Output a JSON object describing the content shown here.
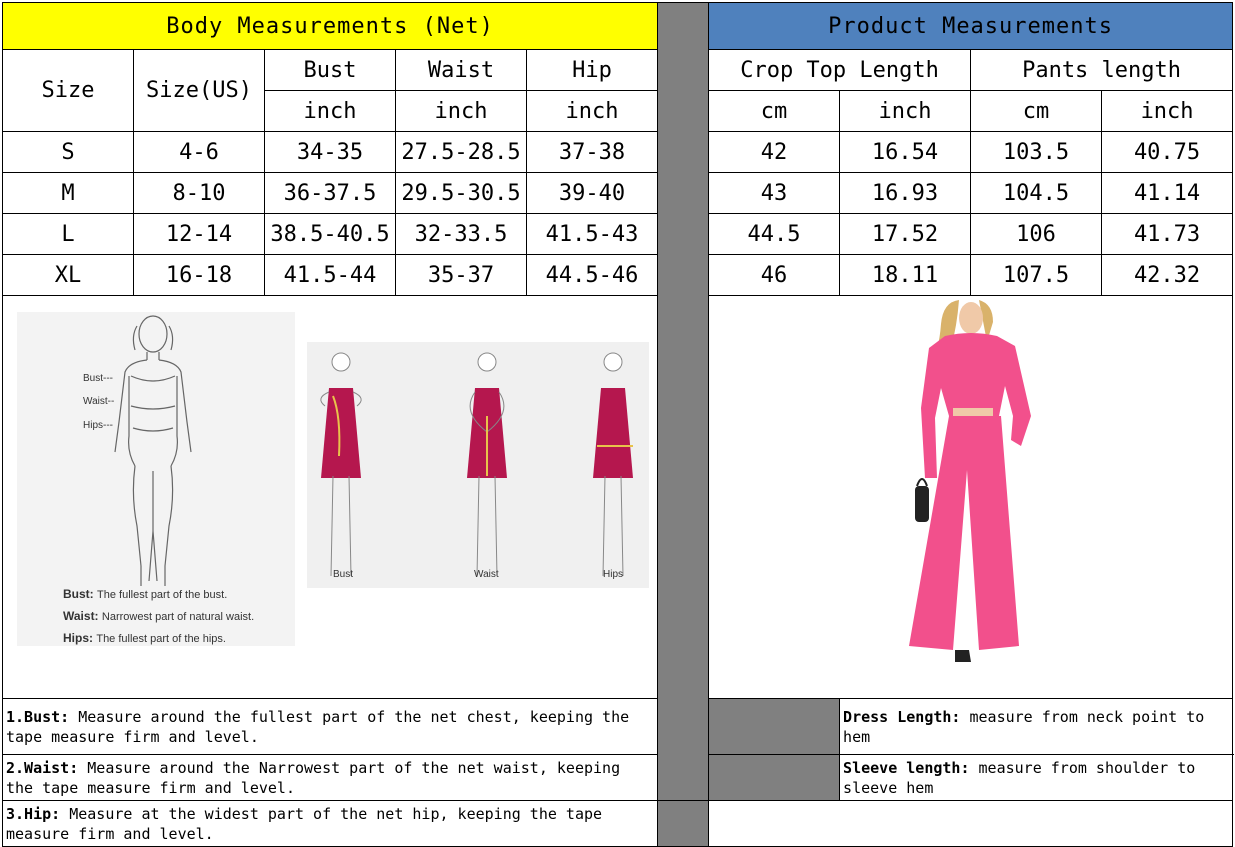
{
  "body_section": {
    "title": "Body Measurements (Net)",
    "headers": {
      "size": "Size",
      "size_us": "Size(US)",
      "bust": "Bust",
      "waist": "Waist",
      "hip": "Hip",
      "unit": "inch"
    },
    "rows": [
      {
        "size": "S",
        "us": "4-6",
        "bust": "34-35",
        "waist": "27.5-28.5",
        "hip": "37-38"
      },
      {
        "size": "M",
        "us": "8-10",
        "bust": "36-37.5",
        "waist": "29.5-30.5",
        "hip": "39-40"
      },
      {
        "size": "L",
        "us": "12-14",
        "bust": "38.5-40.5",
        "waist": "32-33.5",
        "hip": "41.5-43"
      },
      {
        "size": "XL",
        "us": "16-18",
        "bust": "41.5-44",
        "waist": "35-37",
        "hip": "44.5-46"
      }
    ],
    "diagram": {
      "lines": [
        "Bust---",
        "Waist--",
        "Hips---"
      ],
      "legend": [
        {
          "term": "Bust:",
          "desc": "The fullest part of the bust."
        },
        {
          "term": "Waist:",
          "desc": "Narrowest part of natural waist."
        },
        {
          "term": "Hips:",
          "desc": "The fullest part of the hips."
        }
      ],
      "figures": [
        "Bust",
        "Waist",
        "Hips"
      ]
    },
    "notes": [
      {
        "label": "1.Bust:",
        "text": "  Measure around the fullest part of the net chest, keeping the tape  measure firm and level."
      },
      {
        "label": "2.Waist:",
        "text": " Measure around the Narrowest part of the net waist, keeping the tape  measure firm and level."
      },
      {
        "label": "3.Hip:",
        "text": " Measure at the widest part of the net hip, keeping the tape measure firm and level."
      }
    ]
  },
  "product_section": {
    "title": "Product Measurements",
    "headers": {
      "crop_top": "Crop Top Length",
      "pants": "Pants length",
      "cm": "cm",
      "inch": "inch"
    },
    "rows": [
      {
        "top_cm": "42",
        "top_in": "16.54",
        "pants_cm": "103.5",
        "pants_in": "40.75"
      },
      {
        "top_cm": "43",
        "top_in": "16.93",
        "pants_cm": "104.5",
        "pants_in": "41.14"
      },
      {
        "top_cm": "44.5",
        "top_in": "17.52",
        "pants_cm": "106",
        "pants_in": "41.73"
      },
      {
        "top_cm": "46",
        "top_in": "18.11",
        "pants_cm": "107.5",
        "pants_in": "42.32"
      }
    ],
    "notes": [
      {
        "label": "Dress Length:",
        "text": " measure from neck point to hem"
      },
      {
        "label": "Sleeve length:",
        "text": " measure from shoulder to sleeve hem"
      }
    ]
  },
  "colors": {
    "body_header": "#ffff00",
    "product_header": "#4f81bd",
    "divider": "#808080",
    "dress": "#b5174e",
    "outfit": "#f2508c"
  }
}
